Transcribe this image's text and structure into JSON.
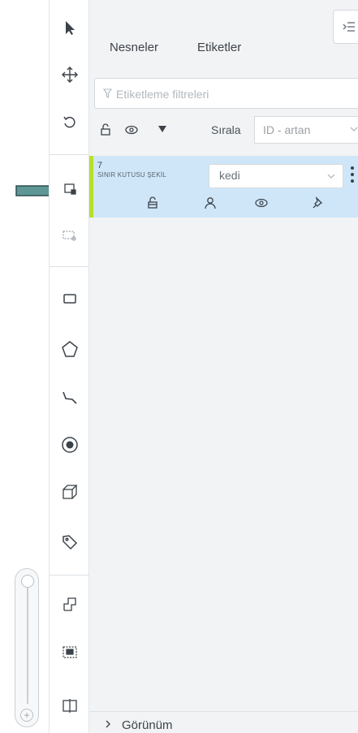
{
  "tabs": {
    "objects": "Nesneler",
    "labels": "Etiketler"
  },
  "filter": {
    "placeholder": "Etiketleme filtreleri"
  },
  "sort": {
    "label": "Sırala",
    "selected": "ID - artan"
  },
  "object_item": {
    "id": "7",
    "type": "SINIR KUTUSU ŞEKİL",
    "label_value": "kedi",
    "accent_color": "#b6e02a"
  },
  "appearance": {
    "label": "Görünüm"
  }
}
